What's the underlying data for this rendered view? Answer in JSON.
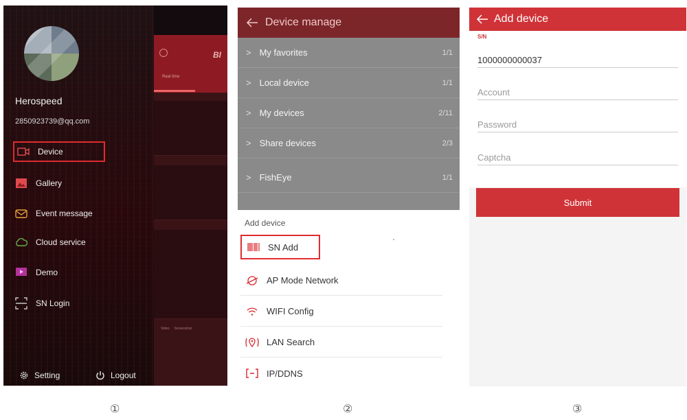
{
  "panel1": {
    "username": "Herospeed",
    "email": "2850923739@qq.com",
    "menu": [
      {
        "label": "Device",
        "icon": "camera-icon"
      },
      {
        "label": "Gallery",
        "icon": "gallery-icon"
      },
      {
        "label": "Event message",
        "icon": "message-icon"
      },
      {
        "label": "Cloud service",
        "icon": "cloud-icon"
      },
      {
        "label": "Demo",
        "icon": "demo-icon"
      },
      {
        "label": "SN Login",
        "icon": "scan-icon"
      }
    ],
    "setting_label": "Setting",
    "logout_label": "Logout",
    "background_app": {
      "logo": "BI",
      "tab": "Real time",
      "toolbar": [
        "Video",
        "Screenshot"
      ]
    }
  },
  "panel2": {
    "title": "Device manage",
    "groups": [
      {
        "label": "My favorites",
        "count": "1/1"
      },
      {
        "label": "Local device",
        "count": "1/1"
      },
      {
        "label": "My devices",
        "count": "2/11"
      },
      {
        "label": "Share devices",
        "count": "2/3"
      },
      {
        "label": "FishEye",
        "count": "1/1"
      }
    ],
    "add_section_label": "Add device",
    "add_options": [
      {
        "label": "SN Add",
        "icon": "barcode-icon"
      },
      {
        "label": "AP Mode Network",
        "icon": "network-icon"
      },
      {
        "label": "WIFI Config",
        "icon": "wifi-icon"
      },
      {
        "label": "LAN Search",
        "icon": "location-search-icon"
      },
      {
        "label": "IP/DDNS",
        "icon": "ip-icon"
      }
    ]
  },
  "panel3": {
    "title": "Add device",
    "sn_label": "S/N",
    "sn_value": "1000000000037",
    "account_placeholder": "Account",
    "password_placeholder": "Password",
    "captcha_placeholder": "Captcha",
    "submit_label": "Submit"
  },
  "captions": [
    "①",
    "②",
    "③"
  ],
  "colors": {
    "accent_red": "#cf3337",
    "highlight_border": "#e02b30",
    "dark_header": "#7c262a"
  }
}
